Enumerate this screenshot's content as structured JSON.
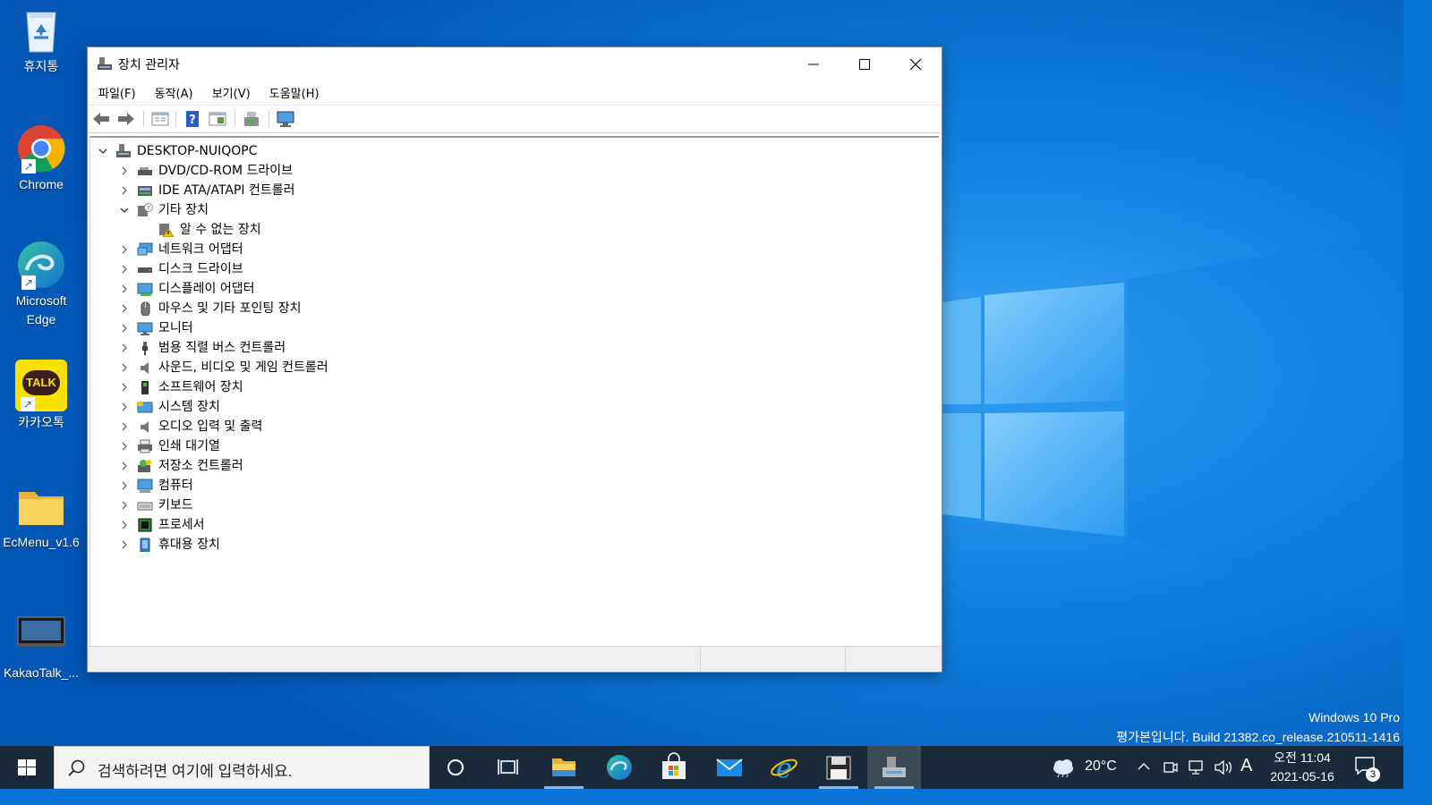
{
  "desktop": {
    "icons": [
      {
        "label": "휴지통",
        "icon": "recycle-bin-icon"
      },
      {
        "label": "Chrome",
        "icon": "chrome-icon"
      },
      {
        "label": "Microsoft Edge",
        "icon": "edge-icon"
      },
      {
        "label": "카카오톡",
        "icon": "kakaotalk-icon",
        "badge_text": "TALK"
      },
      {
        "label": "EcMenu_v1.6",
        "icon": "folder-icon"
      },
      {
        "label": "KakaoTalk_...",
        "icon": "screenshot-file-icon"
      }
    ],
    "watermark": {
      "edition": "Windows 10 Pro",
      "build": "평가본입니다. Build 21382.co_release.210511-1416"
    }
  },
  "window": {
    "title": "장치 관리자",
    "menu": [
      "파일(F)",
      "동작(A)",
      "보기(V)",
      "도움말(H)"
    ],
    "toolbar": [
      "back-icon",
      "forward-icon",
      "properties-icon",
      "help-icon",
      "view-icon",
      "scan-hardware-icon",
      "monitor-icon"
    ],
    "tree": {
      "root": "DESKTOP-NUIQOPC",
      "items": [
        {
          "label": "DVD/CD-ROM 드라이브",
          "icon": "dvd-drive-icon",
          "expanded": false
        },
        {
          "label": "IDE ATA/ATAPI 컨트롤러",
          "icon": "ide-controller-icon",
          "expanded": false
        },
        {
          "label": "기타 장치",
          "icon": "other-devices-icon",
          "expanded": true,
          "children": [
            {
              "label": "알 수 없는 장치",
              "icon": "unknown-device-warning-icon"
            }
          ]
        },
        {
          "label": "네트워크 어댑터",
          "icon": "network-adapter-icon",
          "expanded": false
        },
        {
          "label": "디스크 드라이브",
          "icon": "disk-drive-icon",
          "expanded": false
        },
        {
          "label": "디스플레이 어댑터",
          "icon": "display-adapter-icon",
          "expanded": false
        },
        {
          "label": "마우스 및 기타 포인팅 장치",
          "icon": "mouse-icon",
          "expanded": false
        },
        {
          "label": "모니터",
          "icon": "monitor-icon",
          "expanded": false
        },
        {
          "label": "범용 직렬 버스 컨트롤러",
          "icon": "usb-icon",
          "expanded": false
        },
        {
          "label": "사운드, 비디오 및 게임 컨트롤러",
          "icon": "speaker-icon",
          "expanded": false
        },
        {
          "label": "소프트웨어 장치",
          "icon": "software-device-icon",
          "expanded": false
        },
        {
          "label": "시스템 장치",
          "icon": "system-device-icon",
          "expanded": false
        },
        {
          "label": "오디오 입력 및 출력",
          "icon": "audio-io-icon",
          "expanded": false
        },
        {
          "label": "인쇄 대기열",
          "icon": "printer-icon",
          "expanded": false
        },
        {
          "label": "저장소 컨트롤러",
          "icon": "storage-controller-icon",
          "expanded": false
        },
        {
          "label": "컴퓨터",
          "icon": "computer-icon",
          "expanded": false
        },
        {
          "label": "키보드",
          "icon": "keyboard-icon",
          "expanded": false
        },
        {
          "label": "프로세서",
          "icon": "processor-icon",
          "expanded": false
        },
        {
          "label": "휴대용 장치",
          "icon": "portable-device-icon",
          "expanded": false
        }
      ]
    }
  },
  "taskbar": {
    "search_placeholder": "검색하려면 여기에 입력하세요.",
    "apps": [
      "cortana-icon",
      "task-view-icon",
      "file-explorer-icon",
      "edge-icon",
      "store-icon",
      "mail-icon",
      "internet-explorer-icon",
      "save-app-icon",
      "device-manager-icon"
    ],
    "weather": {
      "temp": "20°C",
      "icon": "cloud-icon"
    },
    "ime": "A",
    "clock": {
      "time": "오전 11:04",
      "date": "2021-05-16"
    },
    "notifications": {
      "count": "3"
    }
  },
  "colors": {
    "desktop_blue": "#0a73d6",
    "taskbar": "#1b2a3a",
    "warning_yellow": "#f5c400",
    "kakao_yellow": "#fae100"
  }
}
